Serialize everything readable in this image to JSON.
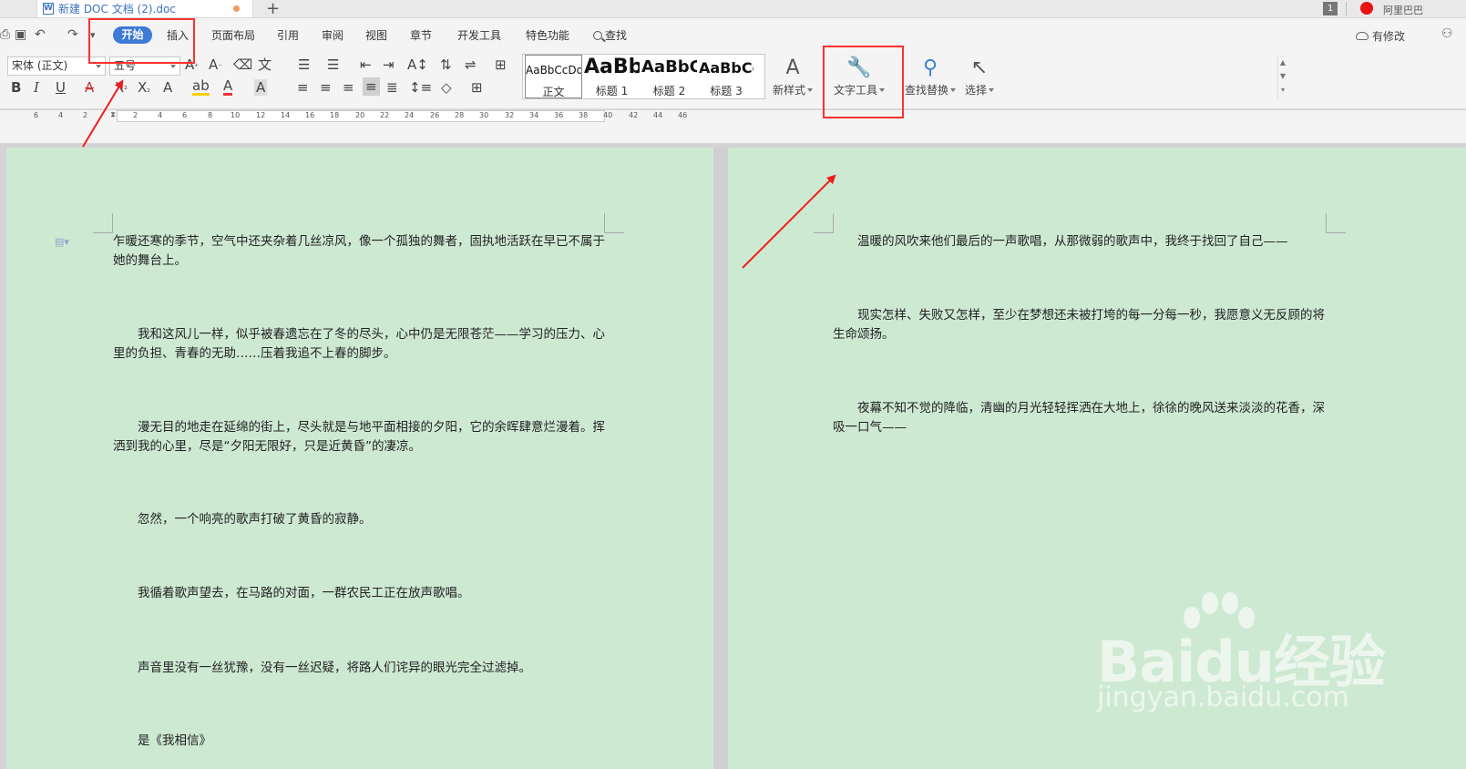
{
  "title_bar": {
    "tab_title": "新建 DOC 文档 (2).doc",
    "new_tab_symbol": "+",
    "window_badge": "1",
    "user_name": "阿里巴巴"
  },
  "menu": {
    "undo_symbol": "↶",
    "redo_symbol": "↷",
    "quick_more_symbol": "▾",
    "active_tab": "开始",
    "tabs": [
      "插入",
      "页面布局",
      "引用",
      "审阅",
      "视图",
      "章节",
      "开发工具",
      "特色功能"
    ],
    "search_label": "查找",
    "edit_status": "有修改"
  },
  "ribbon": {
    "font_name": "宋体 (正文)",
    "font_size": "五号",
    "styles": [
      {
        "preview": "AaBbCcDd",
        "label": "正文"
      },
      {
        "preview": "AaBb",
        "label": "标题 1"
      },
      {
        "preview": "AaBbC",
        "label": "标题 2"
      },
      {
        "preview": "AaBbCc",
        "label": "标题 3"
      }
    ],
    "new_style_label": "新样式",
    "text_tools_label": "文字工具",
    "find_replace_label": "查找替换",
    "select_label": "选择"
  },
  "ruler": {
    "left_numbers": [
      "6",
      "4",
      "2"
    ],
    "numbers": [
      "2",
      "4",
      "6",
      "8",
      "10",
      "12",
      "14",
      "16",
      "18",
      "20",
      "22",
      "24",
      "26",
      "28",
      "30",
      "32",
      "34",
      "36",
      "38",
      "40",
      "42",
      "44",
      "46"
    ]
  },
  "document": {
    "left_page": [
      "乍暖还寒的季节，空气中还夹杂着几丝凉风，像一个孤独的舞者，固执地活跃在早已不属于",
      "她的舞台上。",
      "我和这风儿一样，似乎被春遗忘在了冬的尽头，心中仍是无限苍茫——学习的压力、心",
      "里的负担、青春的无助……压着我追不上春的脚步。",
      "漫无目的地走在延绵的街上，尽头就是与地平面相接的夕阳，它的余晖肆意烂漫着。挥",
      "洒到我的心里，尽是“夕阳无限好，只是近黄昏”的凄凉。",
      "忽然，一个响亮的歌声打破了黄昏的寂静。",
      "我循着歌声望去，在马路的对面，一群农民工正在放声歌唱。",
      "声音里没有一丝犹豫，没有一丝迟疑，将路人们诧异的眼光完全过滤掉。",
      "是《我相信》"
    ],
    "right_page": [
      "温暖的风吹来他们最后的一声歌唱，从那微弱的歌声中，我终于找回了自己——",
      "现实怎样、失败又怎样，至少在梦想还未被打垮的每一分每一秒，我愿意义无反顾的将",
      "生命颂扬。",
      "夜幕不知不觉的降临，清幽的月光轻轻挥洒在大地上，徐徐的晚风送来淡淡的花香，深",
      "吸一口气——"
    ]
  },
  "watermark": {
    "brand": "Baidu经验",
    "url": "jingyan.baidu.com"
  },
  "annotation_color": "#ff3030",
  "page_color": "#cde9d2",
  "accent_color": "#3c7bd6"
}
